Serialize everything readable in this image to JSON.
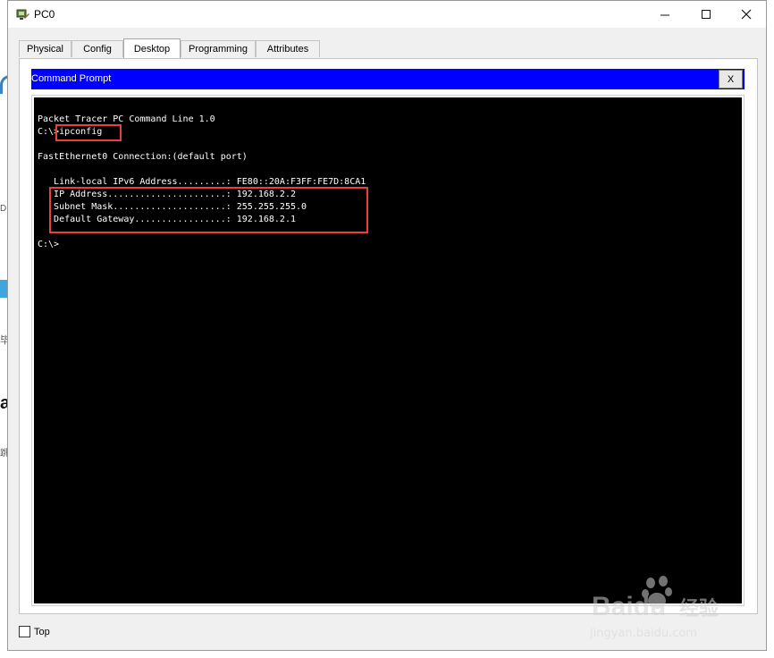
{
  "window": {
    "title": "PC0"
  },
  "tabs": [
    {
      "label": "Physical"
    },
    {
      "label": "Config"
    },
    {
      "label": "Desktop"
    },
    {
      "label": "Programming"
    },
    {
      "label": "Attributes"
    }
  ],
  "active_tab": "Desktop",
  "command_prompt": {
    "title": "Command Prompt",
    "close_label": "X",
    "lines": [
      "Packet Tracer PC Command Line 1.0",
      "C:\\>ipconfig",
      "",
      "FastEthernet0 Connection:(default port)",
      "",
      "   Link-local IPv6 Address.........: FE80::20A:F3FF:FE7D:8CA1",
      "   IP Address......................: 192.168.2.2",
      "   Subnet Mask.....................: 255.255.255.0",
      "   Default Gateway.................: 192.168.2.1",
      "",
      "C:\\>"
    ]
  },
  "footer": {
    "top_checkbox_label": "Top",
    "top_checked": false
  },
  "watermark": {
    "brand": "Baidu",
    "brand_cn": "经验",
    "url": "jingyan.baidu.com"
  },
  "colors": {
    "prompt_titlebar": "#0000ff",
    "terminal_bg": "#000000",
    "terminal_fg": "#ffffff",
    "highlight": "#e8403c"
  },
  "background_fragments": [
    "DI",
    "毕",
    "a",
    "跳"
  ]
}
